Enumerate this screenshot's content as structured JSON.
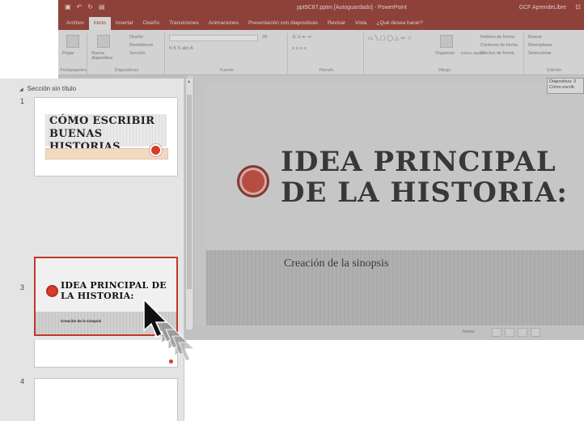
{
  "app": {
    "document_title": "ppt9C87.pptm [Autoguardado] - PowerPoint",
    "account": "GCF AprendeLibre"
  },
  "ribbon_tabs": [
    "Archivo",
    "Inicio",
    "Insertar",
    "Diseño",
    "Transiciones",
    "Animaciones",
    "Presentación con diapositivas",
    "Revisar",
    "Vista",
    "¿Qué desea hacer?"
  ],
  "ribbon": {
    "portapapeles": {
      "paste": "Pegar",
      "group": "Portapapeles"
    },
    "diapositivas": {
      "new_slide": "Nueva diapositiva",
      "layout": "Diseño",
      "reset": "Restablecer",
      "section": "Sección",
      "group": "Diapositivas"
    },
    "fuente": {
      "group": "Fuente",
      "size": "28"
    },
    "parrafo": {
      "group": "Párrafo"
    },
    "dibujo": {
      "arrange": "Organizar",
      "quick_styles": "Estilos rápidos",
      "fill": "Relleno de forma",
      "outline": "Contorno de forma",
      "effects": "Efectos de forma",
      "group": "Dibujo"
    },
    "edicion": {
      "find": "Buscar",
      "replace": "Reemplazar",
      "select": "Seleccionar",
      "group": "Edición"
    }
  },
  "tooltip": {
    "line1": "Diapositiva: 3",
    "line2": "Cómo escrib"
  },
  "main_slide": {
    "title": "IDEA PRINCIPAL DE LA HISTORIA:",
    "subtitle": "Creación de la sinopsis"
  },
  "statusbar": {
    "notes": "Notas"
  },
  "slide_pane": {
    "section_title": "Sección sin título",
    "slides": [
      {
        "number": "1",
        "title": "CÓMO ESCRIBIR BUENAS HISTORIAS"
      },
      {
        "number": "3",
        "title": "IDEA PRINCIPAL DE LA HISTORIA:",
        "subtitle": "Creación de la sinopsis"
      },
      {
        "number": "4"
      }
    ]
  },
  "colors": {
    "accent": "#8b2a1f",
    "selection": "#c0392b",
    "dot": "#d93b2b"
  }
}
